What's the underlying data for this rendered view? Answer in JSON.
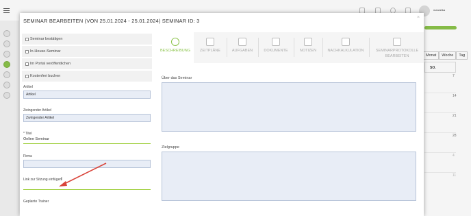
{
  "app": {
    "username": "marcielka"
  },
  "background": {
    "views": [
      "Monat",
      "Woche",
      "Tag"
    ],
    "calendar_header": "SO.",
    "day_numbers": [
      "7",
      "14",
      "21",
      "28",
      "4",
      "11"
    ]
  },
  "modal": {
    "title": "SEMINAR BEARBEITEN  (VON 25.01.2024 - 25.01.2024)   SEMINAR ID: 3",
    "close_symbol": "×",
    "checkboxes": [
      {
        "label": "Seminar bestätigen",
        "checked": false
      },
      {
        "label": "In-House-Seminar",
        "checked": false
      },
      {
        "label": "Im Portal veröffentlichen",
        "checked": false
      },
      {
        "label": "Kostenfrei buchen",
        "checked": false
      }
    ],
    "fields": {
      "artikel_label": "Artikel",
      "artikel_value": "Artikel",
      "zwingender_label": "Zwingender Artikel",
      "zwingender_value": "Zwingender Artikel",
      "titel_label": "* Titel",
      "titel_value": "Online Seminar",
      "firma_label": "Firma",
      "firma_value": "",
      "link_label": "Link zur Sitzung einfügen",
      "link_value": "",
      "trainer_label": "Geplante Trainer"
    },
    "tabs": [
      {
        "label": "BESCHREIBUNG",
        "icon": "info-icon",
        "active": true
      },
      {
        "label": "ZEITPLÄNE",
        "icon": "people-icon",
        "active": false
      },
      {
        "label": "AUFGABEN",
        "icon": "copy-icon",
        "active": false
      },
      {
        "label": "DOKUMENTE",
        "icon": "calendar-icon",
        "active": false
      },
      {
        "label": "NOTIZEN",
        "icon": "notes-icon",
        "active": false
      },
      {
        "label": "NACHKALKULATION",
        "icon": "image-icon",
        "active": false
      },
      {
        "label": "SEMINARPROTOKOLLE BEARBEITEN",
        "icon": "people-icon",
        "active": false
      }
    ],
    "ueber_label": "Über das Seminar",
    "zielgruppe_label": "Zielgruppe",
    "annotation_color": "#d9443a",
    "accent_color": "#8bc34a"
  }
}
